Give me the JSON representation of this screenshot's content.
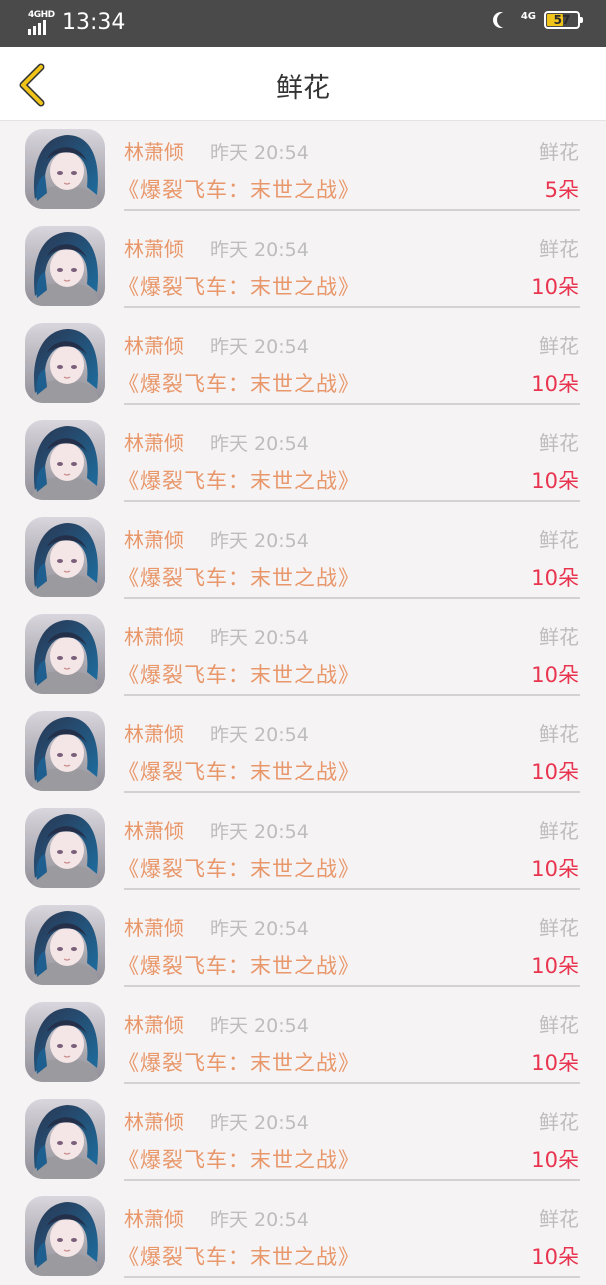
{
  "status_bar": {
    "network": "4GHD",
    "time": "13:34",
    "network_right": "4G",
    "battery": "57",
    "battery_level": 0.57,
    "battery_color": "#f0c419"
  },
  "nav": {
    "back_icon": "chevron-left-icon",
    "title": "鲜花",
    "accent_color": "#f0c419"
  },
  "colors": {
    "name": "#e8976a",
    "count": "#e8344f",
    "muted": "#bdbdbd"
  },
  "items": [
    {
      "name": "林萧倾",
      "time": "昨天 20:54",
      "gift": "鲜花",
      "book": "《爆裂飞车：末世之战》",
      "count": "5朵"
    },
    {
      "name": "林萧倾",
      "time": "昨天 20:54",
      "gift": "鲜花",
      "book": "《爆裂飞车：末世之战》",
      "count": "10朵"
    },
    {
      "name": "林萧倾",
      "time": "昨天 20:54",
      "gift": "鲜花",
      "book": "《爆裂飞车：末世之战》",
      "count": "10朵"
    },
    {
      "name": "林萧倾",
      "time": "昨天 20:54",
      "gift": "鲜花",
      "book": "《爆裂飞车：末世之战》",
      "count": "10朵"
    },
    {
      "name": "林萧倾",
      "time": "昨天 20:54",
      "gift": "鲜花",
      "book": "《爆裂飞车：末世之战》",
      "count": "10朵"
    },
    {
      "name": "林萧倾",
      "time": "昨天 20:54",
      "gift": "鲜花",
      "book": "《爆裂飞车：末世之战》",
      "count": "10朵"
    },
    {
      "name": "林萧倾",
      "time": "昨天 20:54",
      "gift": "鲜花",
      "book": "《爆裂飞车：末世之战》",
      "count": "10朵"
    },
    {
      "name": "林萧倾",
      "time": "昨天 20:54",
      "gift": "鲜花",
      "book": "《爆裂飞车：末世之战》",
      "count": "10朵"
    },
    {
      "name": "林萧倾",
      "time": "昨天 20:54",
      "gift": "鲜花",
      "book": "《爆裂飞车：末世之战》",
      "count": "10朵"
    },
    {
      "name": "林萧倾",
      "time": "昨天 20:54",
      "gift": "鲜花",
      "book": "《爆裂飞车：末世之战》",
      "count": "10朵"
    },
    {
      "name": "林萧倾",
      "time": "昨天 20:54",
      "gift": "鲜花",
      "book": "《爆裂飞车：末世之战》",
      "count": "10朵"
    },
    {
      "name": "林萧倾",
      "time": "昨天 20:54",
      "gift": "鲜花",
      "book": "《爆裂飞车：末世之战》",
      "count": "10朵"
    }
  ]
}
